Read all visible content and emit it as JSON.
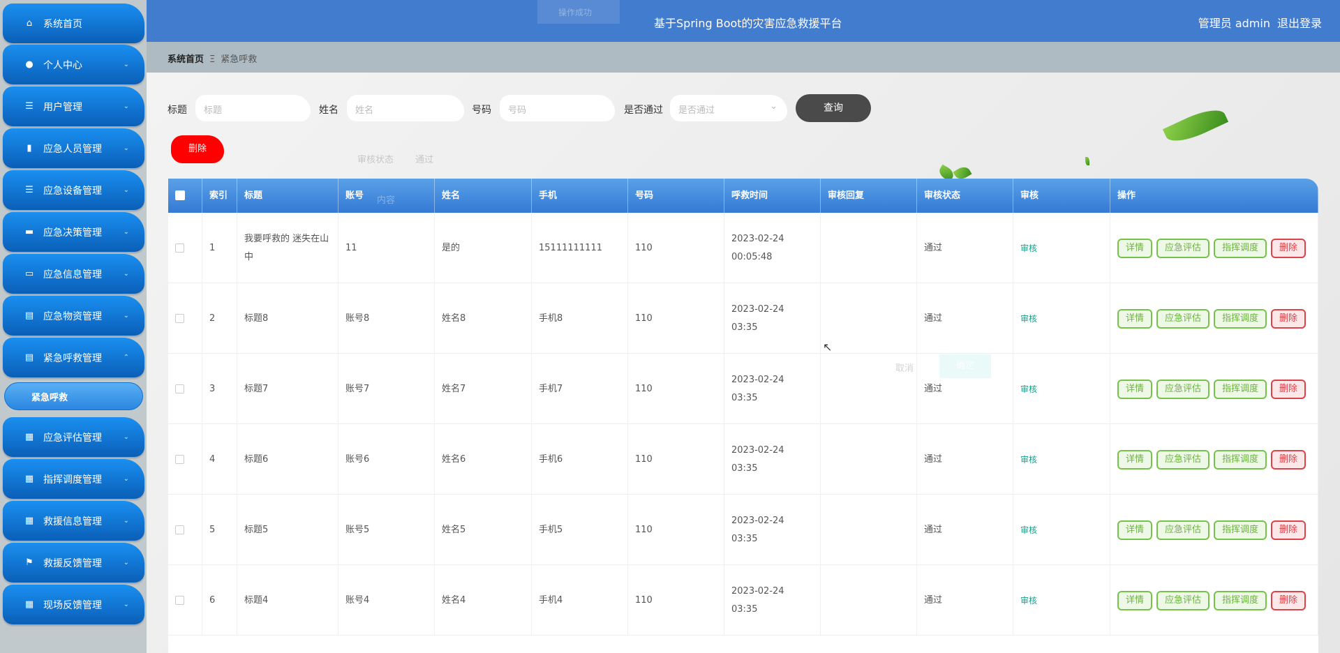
{
  "header": {
    "title": "基于Spring Boot的灾害应急救援平台",
    "user": "管理员 admin",
    "logout": "退出登录",
    "toast": "操作成功"
  },
  "breadcrumb": {
    "home": "系统首页",
    "sep": "Ξ",
    "current": "紧急呼救"
  },
  "sidebar": {
    "items": [
      {
        "label": "系统首页",
        "icon": "home-icon",
        "glyph": "⌂",
        "chev": false
      },
      {
        "label": "个人中心",
        "icon": "user-icon",
        "glyph": "●",
        "chev": true
      },
      {
        "label": "用户管理",
        "icon": "list-icon",
        "glyph": "☰",
        "chev": true
      },
      {
        "label": "应急人员管理",
        "icon": "people-icon",
        "glyph": "▮",
        "chev": true
      },
      {
        "label": "应急设备管理",
        "icon": "list-icon",
        "glyph": "☰",
        "chev": true
      },
      {
        "label": "应急决策管理",
        "icon": "box-icon",
        "glyph": "▬",
        "chev": true
      },
      {
        "label": "应急信息管理",
        "icon": "monitor-icon",
        "glyph": "▭",
        "chev": true
      },
      {
        "label": "应急物资管理",
        "icon": "clipboard-icon",
        "glyph": "▤",
        "chev": true
      },
      {
        "label": "紧急呼救管理",
        "icon": "clipboard-check-icon",
        "glyph": "▤",
        "chev": "up"
      },
      {
        "label": "应急评估管理",
        "icon": "grid-icon",
        "glyph": "▦",
        "chev": true
      },
      {
        "label": "指挥调度管理",
        "icon": "grid-icon",
        "glyph": "▦",
        "chev": true
      },
      {
        "label": "救援信息管理",
        "icon": "grid-icon",
        "glyph": "▦",
        "chev": true
      },
      {
        "label": "救援反馈管理",
        "icon": "flag-icon",
        "glyph": "⚑",
        "chev": true
      },
      {
        "label": "现场反馈管理",
        "icon": "grid-icon",
        "glyph": "▦",
        "chev": true
      }
    ],
    "sub_item": "紧急呼救",
    "chev_down": "⌄",
    "chev_up": "⌃"
  },
  "search": {
    "title_label": "标题",
    "title_ph": "标题",
    "name_label": "姓名",
    "name_ph": "姓名",
    "code_label": "号码",
    "code_ph": "号码",
    "pass_label": "是否通过",
    "pass_ph": "是否通过",
    "query": "查询",
    "delete": "删除"
  },
  "ghost": {
    "status_label": "审核状态",
    "status_value": "通过",
    "content": "内容",
    "cancel": "取消",
    "confirm": "确定"
  },
  "table": {
    "columns": [
      "",
      "索引",
      "标题",
      "账号",
      "姓名",
      "手机",
      "号码",
      "呼救时间",
      "审核回复",
      "审核状态",
      "审核",
      "操作"
    ],
    "rows": [
      {
        "idx": "1",
        "title": "我要呼救的 迷失在山中",
        "account": "11",
        "name": "是的",
        "phone": "15111111111",
        "code": "110",
        "time": "2023-02-24 00:05:48",
        "reply": "",
        "status": "通过",
        "audit": "审核"
      },
      {
        "idx": "2",
        "title": "标题8",
        "account": "账号8",
        "name": "姓名8",
        "phone": "手机8",
        "code": "110",
        "time": "2023-02-24 03:35",
        "reply": "",
        "status": "通过",
        "audit": "审核"
      },
      {
        "idx": "3",
        "title": "标题7",
        "account": "账号7",
        "name": "姓名7",
        "phone": "手机7",
        "code": "110",
        "time": "2023-02-24 03:35",
        "reply": "",
        "status": "通过",
        "audit": "审核"
      },
      {
        "idx": "4",
        "title": "标题6",
        "account": "账号6",
        "name": "姓名6",
        "phone": "手机6",
        "code": "110",
        "time": "2023-02-24 03:35",
        "reply": "",
        "status": "通过",
        "audit": "审核"
      },
      {
        "idx": "5",
        "title": "标题5",
        "account": "账号5",
        "name": "姓名5",
        "phone": "手机5",
        "code": "110",
        "time": "2023-02-24 03:35",
        "reply": "",
        "status": "通过",
        "audit": "审核"
      },
      {
        "idx": "6",
        "title": "标题4",
        "account": "账号4",
        "name": "姓名4",
        "phone": "手机4",
        "code": "110",
        "time": "2023-02-24 03:35",
        "reply": "",
        "status": "通过",
        "audit": "审核"
      }
    ],
    "actions": {
      "detail": "详情",
      "assess": "应急评估",
      "dispatch": "指挥调度",
      "delete": "删除"
    }
  }
}
